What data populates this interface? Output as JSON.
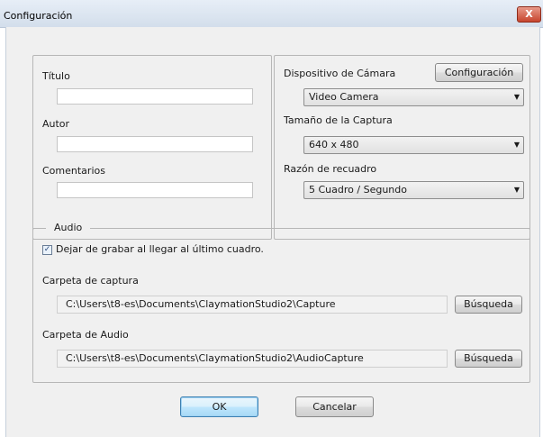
{
  "window": {
    "title": "Configuración",
    "close_label": "X"
  },
  "info": {
    "title_label": "Título",
    "title_value": "",
    "author_label": "Autor",
    "author_value": "",
    "comments_label": "Comentarios",
    "comments_value": ""
  },
  "camera": {
    "device_label": "Dispositivo de Cámara",
    "config_button": "Configuración",
    "device_value": "Video Camera",
    "capture_size_label": "Tamaño de la Captura",
    "capture_size_value": "640 x 480",
    "frame_rate_label": "Razón de recuadro",
    "frame_rate_value": "5 Cuadro / Segundo"
  },
  "audio": {
    "group_label": "Audio",
    "stop_checkbox_label": "Dejar de grabar al llegar al último cuadro.",
    "stop_checked": true,
    "capture_folder_label": "Carpeta de captura",
    "capture_folder_value": "C:\\Users\\t8-es\\Documents\\ClaymationStudio2\\Capture",
    "capture_browse_button": "Búsqueda",
    "audio_folder_label": "Carpeta de Audio",
    "audio_folder_value": "C:\\Users\\t8-es\\Documents\\ClaymationStudio2\\AudioCapture",
    "audio_browse_button": "Búsqueda"
  },
  "footer": {
    "ok_label": "OK",
    "cancel_label": "Cancelar"
  }
}
